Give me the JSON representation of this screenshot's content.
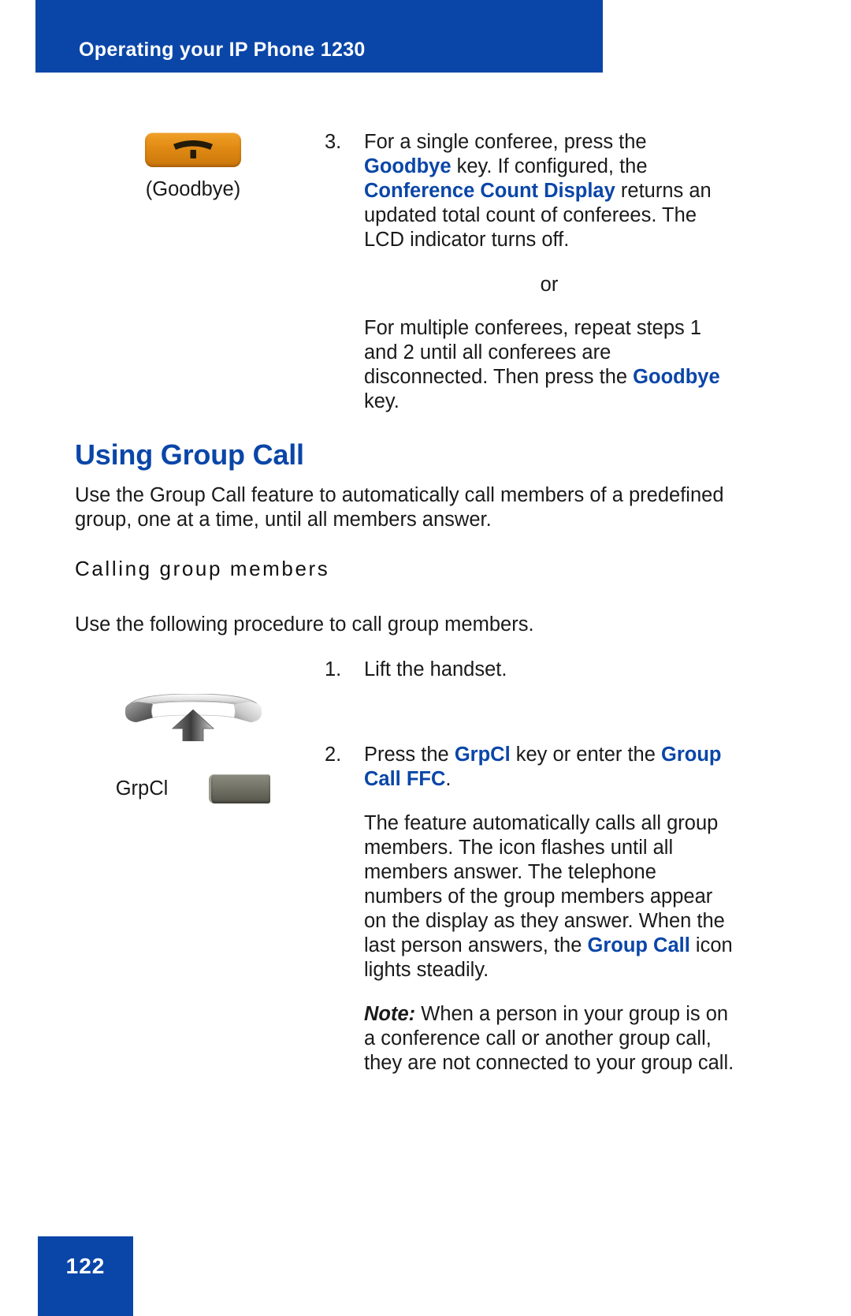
{
  "header": {
    "title": "Operating your IP Phone 1230",
    "bar_color": "#0a46a8"
  },
  "accent_color": "#0a46a8",
  "steps_top": {
    "step3": {
      "number": "3.",
      "text_1": "For a single conferee, press the ",
      "kw_1": "Goodbye",
      "text_2": " key. If configured, the ",
      "kw_2": "Conference Count Display",
      "text_3": " returns an updated total count of conferees. The LCD indicator turns off."
    },
    "or_label": "or",
    "multiple": {
      "text_1": "For multiple conferees, repeat steps 1 and 2 until all conferees are disconnected. Then press the ",
      "kw_1": "Goodbye",
      "text_2": " key."
    },
    "goodbye_icon": {
      "icon_name": "goodbye-key-icon",
      "caption": "(Goodbye)",
      "color": "#e08a14"
    }
  },
  "section": {
    "heading": "Using Group Call",
    "intro": "Use the Group Call feature to automatically call members of a predefined group, one at a time, until all members answer.",
    "subheading": "Calling group members",
    "sub_intro": "Use the following procedure to call group members."
  },
  "steps_bottom": {
    "step1": {
      "number": "1.",
      "text": "Lift the handset.",
      "icon_name": "lift-handset-icon"
    },
    "step2": {
      "number": "2.",
      "text_1": "Press the ",
      "kw_1": "GrpCl",
      "text_2": " key or enter the ",
      "kw_2": "Group Call FFC",
      "text_3": ".",
      "key_label": "GrpCl",
      "key_icon_name": "grpcl-key-icon"
    },
    "detail": "The feature automatically calls all group members. The icon flashes until all members answer. The telephone numbers of the group members appear on the display as they answer. When the last person answers, the ",
    "detail_kw": "Group Call",
    "detail_tail": " icon lights steadily.",
    "note_label": "Note:",
    "note_text": " When a person in your group is on a conference call or another group call, they are not connected to your group call."
  },
  "footer": {
    "page_number": "122",
    "box_color": "#0a46a8"
  }
}
